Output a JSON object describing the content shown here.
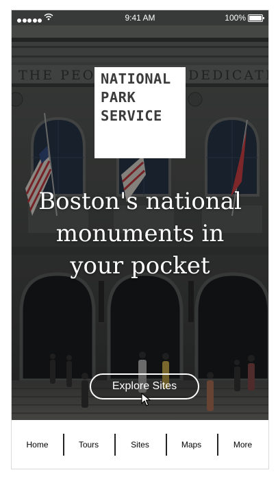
{
  "status_bar": {
    "time": "9:41 AM",
    "battery": "100%",
    "signal_icon": "signal-dots-icon",
    "wifi_icon": "wifi-icon",
    "battery_icon": "battery-full-icon"
  },
  "hero": {
    "logo_lines": [
      "NATIONAL",
      "PARK",
      "SERVICE"
    ],
    "headline_lines": [
      "Boston's national",
      "monuments in",
      "your pocket"
    ],
    "cta_label": "Explore Sites",
    "facade_inscription": "THE PEOPLE DEDICATED"
  },
  "tabs": [
    {
      "label": "Home"
    },
    {
      "label": "Tours"
    },
    {
      "label": "Sites"
    },
    {
      "label": "Maps"
    },
    {
      "label": "More"
    }
  ],
  "colors": {
    "overlay": "#1a1a1a",
    "text": "#ffffff",
    "logo_text": "#3b3b3b",
    "tab_bg": "#ffffff"
  }
}
